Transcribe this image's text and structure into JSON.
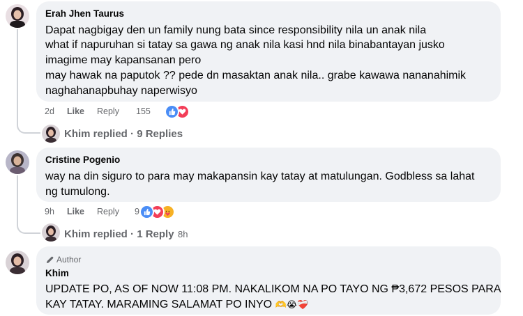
{
  "comments": [
    {
      "author": "Erah Jhen Taurus",
      "lines": [
        "Dapat nagbigay den un family nung bata since responsibility nila un anak nila",
        "what if napuruhan si tatay sa gawa ng anak nila kasi hnd nila binabantayan jusko",
        "imagime may kapansanan pero",
        "may hawak na paputok ?? pede dn masaktan anak nila.. grabe kawawa nananahimik",
        "naghahanapbuhay naperwisyo"
      ],
      "time": "2d",
      "like_label": "Like",
      "reply_label": "Reply",
      "reaction_count": "155",
      "reactions": [
        "like-icon",
        "love-icon"
      ],
      "reply_summary": {
        "name": "Khim replied",
        "sep": " · ",
        "count": "9 Replies",
        "time": ""
      }
    },
    {
      "author": "Cristine Pogenio",
      "lines": [
        "way na din siguro to para may makapansin kay tatay at matulungan. Godbless sa lahat",
        "ng tumulong."
      ],
      "time": "9h",
      "like_label": "Like",
      "reply_label": "Reply",
      "reaction_count": "9",
      "reactions": [
        "like-icon",
        "love-icon",
        "care-icon"
      ],
      "reply_summary": {
        "name": "Khim replied",
        "sep": " · ",
        "count": "1 Reply",
        "time": "8h"
      }
    },
    {
      "badge": "Author",
      "author": "Khim",
      "lines": [
        "UPDATE PO, AS OF NOW 11:08 PM. NAKALIKOM NA PO TAYO NG ₱3,672 PESOS PARA",
        "KAY TATAY. MARAMING SALAMAT PO INYO"
      ],
      "emojis": [
        "🫶",
        "😭",
        "❤️‍🩹"
      ]
    }
  ],
  "colors": {
    "bubble": "#f0f2f5",
    "secondary_text": "#65676b",
    "like_blue": "#1877f2",
    "love_red": "#f33e58",
    "care_yellow": "#f7b125"
  }
}
